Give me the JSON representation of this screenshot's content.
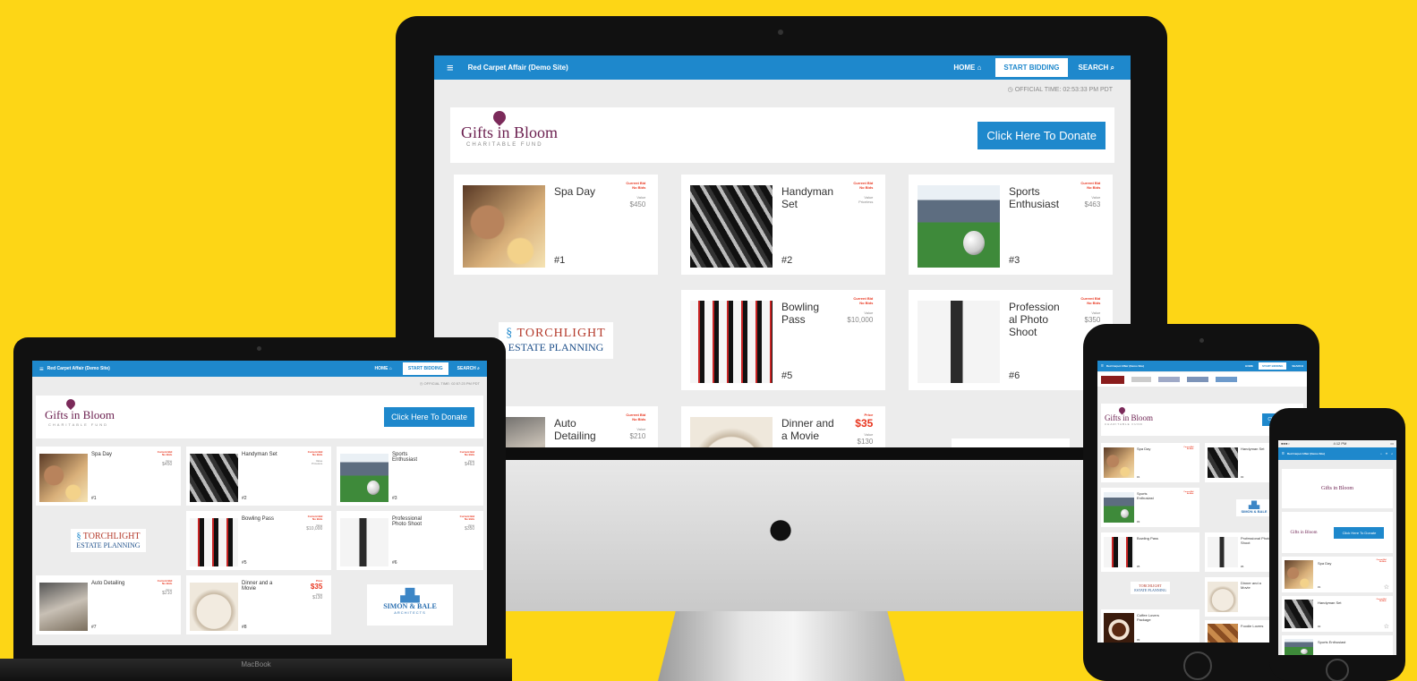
{
  "site": {
    "title": "Red Carpet Affair (Demo Site)",
    "nav": {
      "home": "HOME",
      "start_bidding": "START BIDDING",
      "search": "SEARCH"
    },
    "official_time_imac": "OFFICIAL TIME: 02:53:33 PM PDT",
    "official_time_mb": "OFFICIAL TIME: 02:57:23 PM PDT",
    "donate_label": "Click Here To Donate",
    "donate_label_short": "Click Here To",
    "charity": {
      "name": "Gifts in Bloom",
      "sub": "CHARITABLE FUND"
    }
  },
  "bid": {
    "current": "Current Bid",
    "none": "No Bids",
    "value": "Value",
    "priceless": "Priceless",
    "price": "Price"
  },
  "items": {
    "spa": {
      "name": "Spa Day",
      "num": "#1",
      "value": "$450"
    },
    "handyman": {
      "name": "Handyman Set",
      "num": "#2"
    },
    "sports": {
      "name": "Sports Enthusiast",
      "num": "#3",
      "value": "$463"
    },
    "bowling": {
      "name": "Bowling Pass",
      "num": "#5",
      "value": "$10,000"
    },
    "photo": {
      "name": "Professional Photo Shoot",
      "name_split": "Profession al Photo Shoot",
      "num": "#6",
      "value": "$350"
    },
    "auto": {
      "name": "Auto Detailing",
      "num": "#7",
      "value": "$210"
    },
    "dinner": {
      "name": "Dinner and a Movie",
      "num": "#8",
      "price": "$35",
      "value": "$130"
    },
    "coffee": {
      "name": "Coffee Lovers Package",
      "num": "#9"
    },
    "foodie": {
      "name": "Foodie Lovers"
    }
  },
  "sponsors": {
    "torchlight": {
      "line1": "TORCHLIGHT",
      "line2": "ESTATE PLANNING"
    },
    "simon": {
      "line1": "SIMON & BALE",
      "line2": "ARCHITECTS"
    }
  },
  "devices": {
    "macbook_label": "MacBook"
  },
  "iphone": {
    "status_time": "4:12 PM"
  },
  "colors": {
    "background": "#fdd616",
    "brand_blue": "#1e88cc",
    "bid_red": "#e8361f"
  }
}
